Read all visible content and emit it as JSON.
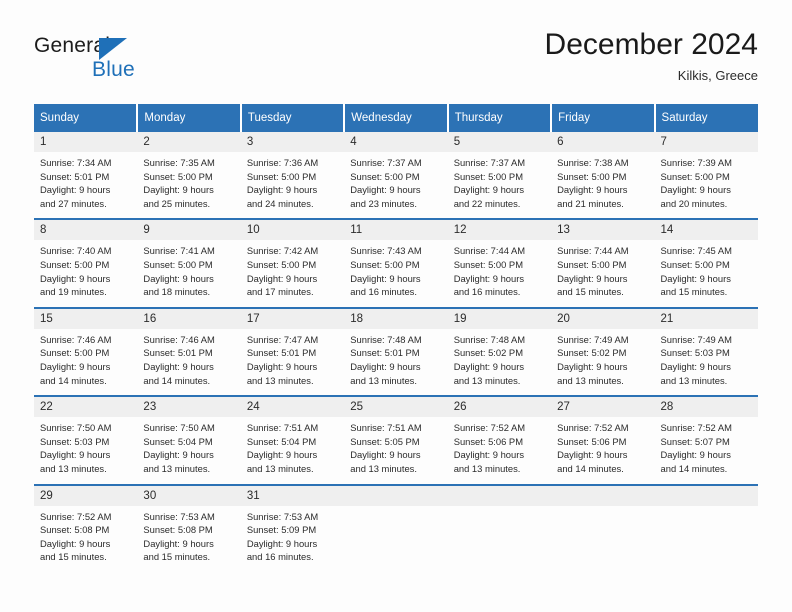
{
  "brand": {
    "name_top": "General",
    "name_bottom": "Blue",
    "logo_icon": "triangle-logo-icon"
  },
  "header": {
    "title": "December 2024",
    "subtitle": "Kilkis, Greece"
  },
  "colors": {
    "header_blue": "#2c72b5",
    "brand_blue": "#1f70b8",
    "daynum_band": "#efefef",
    "text": "#2b2b2b"
  },
  "calendar": {
    "weekday_headers": [
      "Sunday",
      "Monday",
      "Tuesday",
      "Wednesday",
      "Thursday",
      "Friday",
      "Saturday"
    ],
    "weeks": [
      [
        {
          "day": "1",
          "sunrise": "Sunrise: 7:34 AM",
          "sunset": "Sunset: 5:01 PM",
          "daylight1": "Daylight: 9 hours",
          "daylight2": "and 27 minutes."
        },
        {
          "day": "2",
          "sunrise": "Sunrise: 7:35 AM",
          "sunset": "Sunset: 5:00 PM",
          "daylight1": "Daylight: 9 hours",
          "daylight2": "and 25 minutes."
        },
        {
          "day": "3",
          "sunrise": "Sunrise: 7:36 AM",
          "sunset": "Sunset: 5:00 PM",
          "daylight1": "Daylight: 9 hours",
          "daylight2": "and 24 minutes."
        },
        {
          "day": "4",
          "sunrise": "Sunrise: 7:37 AM",
          "sunset": "Sunset: 5:00 PM",
          "daylight1": "Daylight: 9 hours",
          "daylight2": "and 23 minutes."
        },
        {
          "day": "5",
          "sunrise": "Sunrise: 7:37 AM",
          "sunset": "Sunset: 5:00 PM",
          "daylight1": "Daylight: 9 hours",
          "daylight2": "and 22 minutes."
        },
        {
          "day": "6",
          "sunrise": "Sunrise: 7:38 AM",
          "sunset": "Sunset: 5:00 PM",
          "daylight1": "Daylight: 9 hours",
          "daylight2": "and 21 minutes."
        },
        {
          "day": "7",
          "sunrise": "Sunrise: 7:39 AM",
          "sunset": "Sunset: 5:00 PM",
          "daylight1": "Daylight: 9 hours",
          "daylight2": "and 20 minutes."
        }
      ],
      [
        {
          "day": "8",
          "sunrise": "Sunrise: 7:40 AM",
          "sunset": "Sunset: 5:00 PM",
          "daylight1": "Daylight: 9 hours",
          "daylight2": "and 19 minutes."
        },
        {
          "day": "9",
          "sunrise": "Sunrise: 7:41 AM",
          "sunset": "Sunset: 5:00 PM",
          "daylight1": "Daylight: 9 hours",
          "daylight2": "and 18 minutes."
        },
        {
          "day": "10",
          "sunrise": "Sunrise: 7:42 AM",
          "sunset": "Sunset: 5:00 PM",
          "daylight1": "Daylight: 9 hours",
          "daylight2": "and 17 minutes."
        },
        {
          "day": "11",
          "sunrise": "Sunrise: 7:43 AM",
          "sunset": "Sunset: 5:00 PM",
          "daylight1": "Daylight: 9 hours",
          "daylight2": "and 16 minutes."
        },
        {
          "day": "12",
          "sunrise": "Sunrise: 7:44 AM",
          "sunset": "Sunset: 5:00 PM",
          "daylight1": "Daylight: 9 hours",
          "daylight2": "and 16 minutes."
        },
        {
          "day": "13",
          "sunrise": "Sunrise: 7:44 AM",
          "sunset": "Sunset: 5:00 PM",
          "daylight1": "Daylight: 9 hours",
          "daylight2": "and 15 minutes."
        },
        {
          "day": "14",
          "sunrise": "Sunrise: 7:45 AM",
          "sunset": "Sunset: 5:00 PM",
          "daylight1": "Daylight: 9 hours",
          "daylight2": "and 15 minutes."
        }
      ],
      [
        {
          "day": "15",
          "sunrise": "Sunrise: 7:46 AM",
          "sunset": "Sunset: 5:00 PM",
          "daylight1": "Daylight: 9 hours",
          "daylight2": "and 14 minutes."
        },
        {
          "day": "16",
          "sunrise": "Sunrise: 7:46 AM",
          "sunset": "Sunset: 5:01 PM",
          "daylight1": "Daylight: 9 hours",
          "daylight2": "and 14 minutes."
        },
        {
          "day": "17",
          "sunrise": "Sunrise: 7:47 AM",
          "sunset": "Sunset: 5:01 PM",
          "daylight1": "Daylight: 9 hours",
          "daylight2": "and 13 minutes."
        },
        {
          "day": "18",
          "sunrise": "Sunrise: 7:48 AM",
          "sunset": "Sunset: 5:01 PM",
          "daylight1": "Daylight: 9 hours",
          "daylight2": "and 13 minutes."
        },
        {
          "day": "19",
          "sunrise": "Sunrise: 7:48 AM",
          "sunset": "Sunset: 5:02 PM",
          "daylight1": "Daylight: 9 hours",
          "daylight2": "and 13 minutes."
        },
        {
          "day": "20",
          "sunrise": "Sunrise: 7:49 AM",
          "sunset": "Sunset: 5:02 PM",
          "daylight1": "Daylight: 9 hours",
          "daylight2": "and 13 minutes."
        },
        {
          "day": "21",
          "sunrise": "Sunrise: 7:49 AM",
          "sunset": "Sunset: 5:03 PM",
          "daylight1": "Daylight: 9 hours",
          "daylight2": "and 13 minutes."
        }
      ],
      [
        {
          "day": "22",
          "sunrise": "Sunrise: 7:50 AM",
          "sunset": "Sunset: 5:03 PM",
          "daylight1": "Daylight: 9 hours",
          "daylight2": "and 13 minutes."
        },
        {
          "day": "23",
          "sunrise": "Sunrise: 7:50 AM",
          "sunset": "Sunset: 5:04 PM",
          "daylight1": "Daylight: 9 hours",
          "daylight2": "and 13 minutes."
        },
        {
          "day": "24",
          "sunrise": "Sunrise: 7:51 AM",
          "sunset": "Sunset: 5:04 PM",
          "daylight1": "Daylight: 9 hours",
          "daylight2": "and 13 minutes."
        },
        {
          "day": "25",
          "sunrise": "Sunrise: 7:51 AM",
          "sunset": "Sunset: 5:05 PM",
          "daylight1": "Daylight: 9 hours",
          "daylight2": "and 13 minutes."
        },
        {
          "day": "26",
          "sunrise": "Sunrise: 7:52 AM",
          "sunset": "Sunset: 5:06 PM",
          "daylight1": "Daylight: 9 hours",
          "daylight2": "and 13 minutes."
        },
        {
          "day": "27",
          "sunrise": "Sunrise: 7:52 AM",
          "sunset": "Sunset: 5:06 PM",
          "daylight1": "Daylight: 9 hours",
          "daylight2": "and 14 minutes."
        },
        {
          "day": "28",
          "sunrise": "Sunrise: 7:52 AM",
          "sunset": "Sunset: 5:07 PM",
          "daylight1": "Daylight: 9 hours",
          "daylight2": "and 14 minutes."
        }
      ],
      [
        {
          "day": "29",
          "sunrise": "Sunrise: 7:52 AM",
          "sunset": "Sunset: 5:08 PM",
          "daylight1": "Daylight: 9 hours",
          "daylight2": "and 15 minutes."
        },
        {
          "day": "30",
          "sunrise": "Sunrise: 7:53 AM",
          "sunset": "Sunset: 5:08 PM",
          "daylight1": "Daylight: 9 hours",
          "daylight2": "and 15 minutes."
        },
        {
          "day": "31",
          "sunrise": "Sunrise: 7:53 AM",
          "sunset": "Sunset: 5:09 PM",
          "daylight1": "Daylight: 9 hours",
          "daylight2": "and 16 minutes."
        },
        {
          "day": "",
          "sunrise": "",
          "sunset": "",
          "daylight1": "",
          "daylight2": ""
        },
        {
          "day": "",
          "sunrise": "",
          "sunset": "",
          "daylight1": "",
          "daylight2": ""
        },
        {
          "day": "",
          "sunrise": "",
          "sunset": "",
          "daylight1": "",
          "daylight2": ""
        },
        {
          "day": "",
          "sunrise": "",
          "sunset": "",
          "daylight1": "",
          "daylight2": ""
        }
      ]
    ]
  }
}
